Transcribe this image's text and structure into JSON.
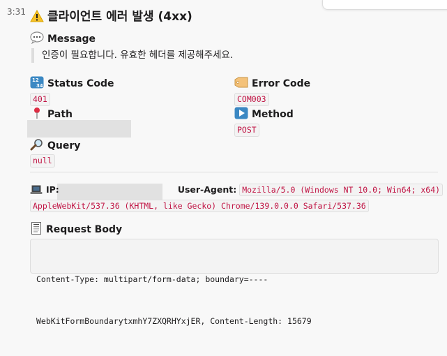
{
  "message_time": "3:31",
  "title": {
    "icon": "warning-icon",
    "text": "클라이언트 에러 발생 (4xx)"
  },
  "message": {
    "icon": "speech-bubble-icon",
    "heading": "Message",
    "text": "인증이 필요합니다. 유효한 헤더를 제공해주세요."
  },
  "status_code": {
    "icon": "numbers-icon",
    "heading": "Status Code",
    "value": "401"
  },
  "error_code": {
    "icon": "label-tag-icon",
    "heading": "Error Code",
    "value": "COM003"
  },
  "path": {
    "icon": "pushpin-icon",
    "heading": "Path"
  },
  "method": {
    "icon": "play-button-icon",
    "heading": "Method",
    "value": "POST"
  },
  "query": {
    "icon": "magnifier-icon",
    "heading": "Query",
    "value": "null"
  },
  "client": {
    "icon": "laptop-icon",
    "ip_label": "IP:",
    "ua_label": "User-Agent:",
    "ua_line1": "Mozilla/5.0 (Windows NT 10.0; Win64; x64)",
    "ua_line2": "AppleWebKit/537.36 (KHTML, like Gecko) Chrome/139.0.0.0 Safari/537.36"
  },
  "request_body": {
    "icon": "receipt-icon",
    "heading": "Request Body",
    "line1": "Content-Type: multipart/form-data; boundary=----",
    "line2": "WebKitFormBoundarytxmhY7ZXQRHYxjER, Content-Length: 15679"
  },
  "colors": {
    "code_text": "#c01343",
    "code_bg": "#f3f3f3",
    "redaction": "#e1e1e1"
  }
}
